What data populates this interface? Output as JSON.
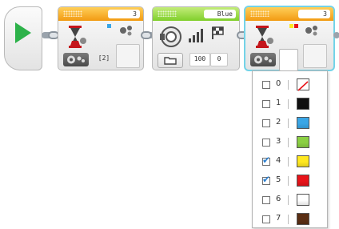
{
  "blocks": {
    "wait_block_1": {
      "label": "3",
      "param": "[2]"
    },
    "sound_block": {
      "label": "Blue",
      "params": [
        "100",
        "0"
      ]
    },
    "wait_block_2": {
      "label": "3"
    }
  },
  "color_dropdown": {
    "options": [
      {
        "number": "0",
        "checked": false,
        "color_name": "no-color",
        "color": "#ffffff"
      },
      {
        "number": "1",
        "checked": false,
        "color_name": "black",
        "color": "#111111"
      },
      {
        "number": "2",
        "checked": false,
        "color_name": "blue",
        "color": "#3aa6e6"
      },
      {
        "number": "3",
        "checked": false,
        "color_name": "green",
        "color": "#8bd043"
      },
      {
        "number": "4",
        "checked": true,
        "color_name": "yellow",
        "color": "#ffe820"
      },
      {
        "number": "5",
        "checked": true,
        "color_name": "red",
        "color": "#e8141a"
      },
      {
        "number": "6",
        "checked": false,
        "color_name": "white",
        "color": "#ffffff"
      },
      {
        "number": "7",
        "checked": false,
        "color_name": "brown",
        "color": "#5a2e14"
      }
    ]
  },
  "colors": {
    "accent_orange": "#f29a12",
    "accent_green": "#7fcf2b",
    "start_green": "#2db24a",
    "selection_cyan": "#73d3e8"
  }
}
